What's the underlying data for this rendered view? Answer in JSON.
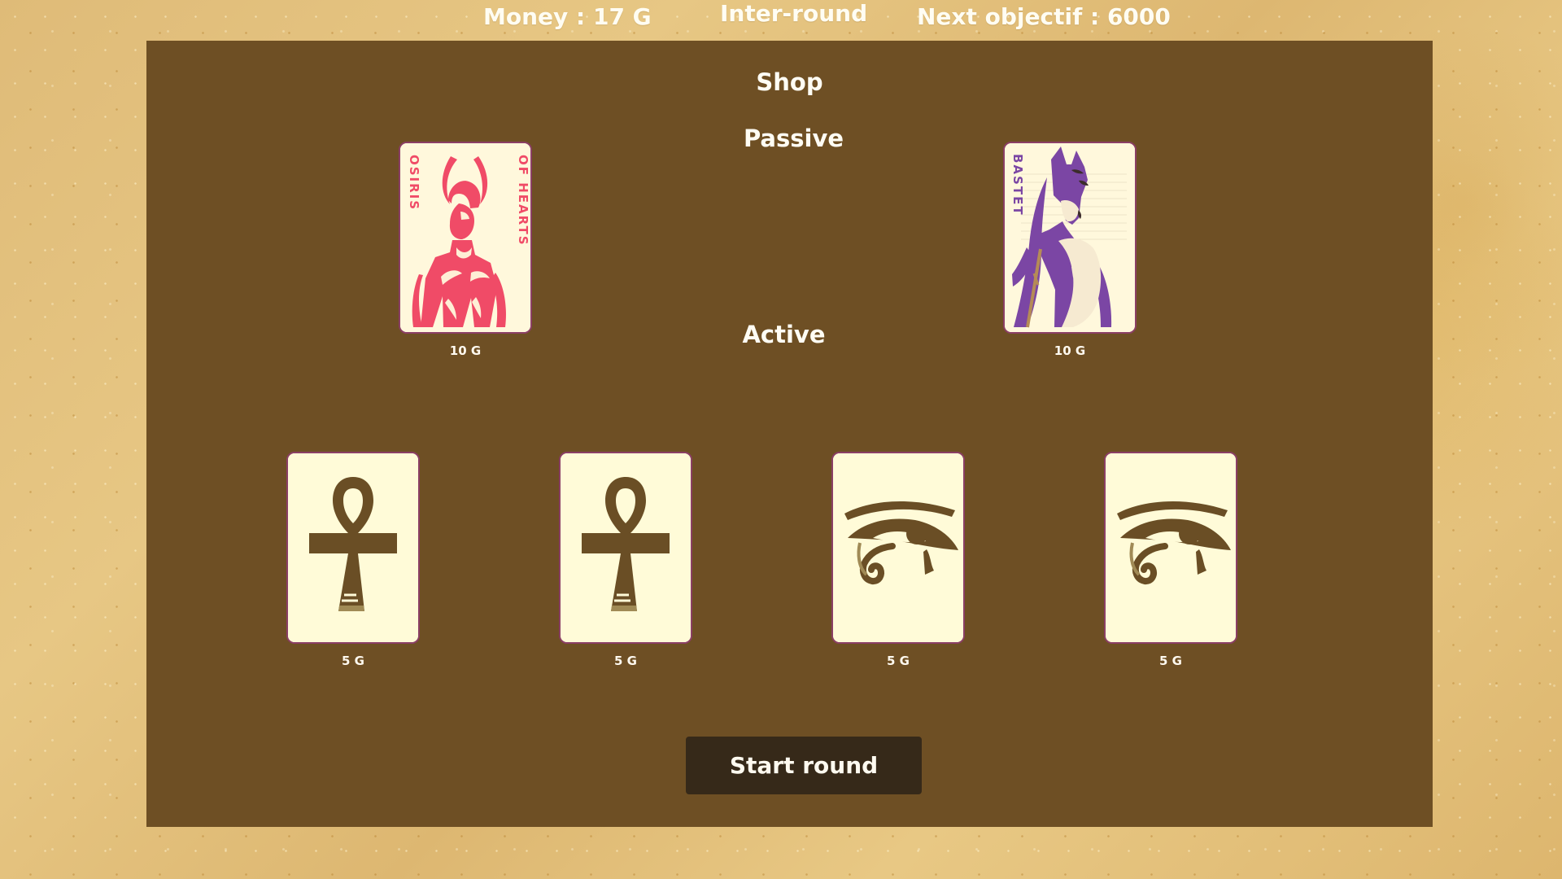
{
  "header": {
    "money": "Money : 17 G",
    "phase": "Inter-round",
    "objective": "Next objectif : 6000"
  },
  "shop": {
    "title": "Shop",
    "passive_title": "Passive",
    "active_title": "Active",
    "passive_cards": [
      {
        "name": "osiris-card",
        "left_text": "OSIRIS",
        "right_text": "OF HEARTS",
        "price": "10 G",
        "accent": "#f04b67",
        "icon": "winged-deity-icon"
      },
      {
        "name": "bastet-card",
        "left_text": "BASTET",
        "price": "10 G",
        "accent": "#7b46a4",
        "icon": "cat-goddess-icon"
      }
    ],
    "active_cards": [
      {
        "name": "ankh-card",
        "price": "5 G",
        "icon": "ankh-icon"
      },
      {
        "name": "ankh-card",
        "price": "5 G",
        "icon": "ankh-icon"
      },
      {
        "name": "eye-card",
        "price": "5 G",
        "icon": "eye-of-horus-icon"
      },
      {
        "name": "eye-card",
        "price": "5 G",
        "icon": "eye-of-horus-icon"
      }
    ],
    "start_button": "Start round"
  },
  "colors": {
    "background": "#e3c07c",
    "panel": "#6e4f24",
    "card_bg": "#fffbd8",
    "card_border": "#8b3f65",
    "icon_brown": "#6a4e25",
    "button": "#362919"
  }
}
